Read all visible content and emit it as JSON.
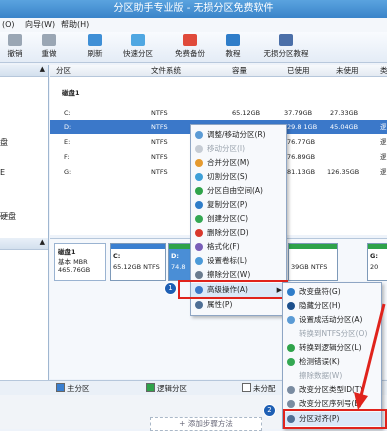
{
  "title": "分区助手专业版 - 无损分区免费软件",
  "menu": [
    "(O)",
    "向导(W)",
    "帮助(H)"
  ],
  "toolbar": [
    {
      "label": "撤销",
      "icon": "undo-icon"
    },
    {
      "label": "重做",
      "icon": "redo-icon"
    },
    {
      "label": "刷新",
      "icon": "refresh-icon"
    },
    {
      "label": "快速分区",
      "icon": "quick-partition-icon"
    },
    {
      "label": "免费备份",
      "icon": "backup-icon"
    },
    {
      "label": "教程",
      "icon": "tutorial-icon"
    },
    {
      "label": "无损分区教程",
      "icon": "lossless-tutorial-icon"
    }
  ],
  "left_panel": {
    "items": [
      "盘",
      "E",
      "",
      "硬盘"
    ]
  },
  "table": {
    "headers": [
      "分区",
      "文件系统",
      "容量",
      "已使用",
      "未使用",
      "类"
    ],
    "disk_label": "磁盘1",
    "rows": [
      {
        "part": "C:",
        "fs": "NTFS",
        "cap": "65.12GB",
        "used": "37.79GB",
        "free": "27.33GB",
        "type": ""
      },
      {
        "part": "D:",
        "fs": "NTFS",
        "cap": "",
        "used": "29.8 1GB",
        "free": "45.04GB",
        "type": "逻"
      },
      {
        "part": "E:",
        "fs": "NTFS",
        "cap": "",
        "used": "76.77GB",
        "free": "",
        "type": "逻"
      },
      {
        "part": "F:",
        "fs": "NTFS",
        "cap": "",
        "used": "76.89GB",
        "free": "",
        "type": "逻"
      },
      {
        "part": "G:",
        "fs": "NTFS",
        "cap": "",
        "used": "81.13GB",
        "free": "126.35GB",
        "type": "逻"
      }
    ]
  },
  "diskmap": {
    "disk": {
      "name": "磁盘1",
      "type": "基本 MBR",
      "size": "465.76GB"
    },
    "parts": [
      {
        "letter": "C:",
        "info": "65.12GB NTFS"
      },
      {
        "letter": "D:",
        "info": "74.8"
      },
      {
        "letter": "",
        "info": "39GB NTFS"
      },
      {
        "letter": "G:",
        "info": "20"
      }
    ]
  },
  "legend": [
    "主分区",
    "逻辑分区",
    "未分配"
  ],
  "bottom_text": "添加步骤方法",
  "context_menu": [
    {
      "label": "调整/移动分区(R)",
      "disabled": false
    },
    {
      "label": "移动分区(I)",
      "disabled": true
    },
    {
      "label": "合并分区(M)",
      "disabled": false
    },
    {
      "label": "切割分区(S)",
      "disabled": false
    },
    {
      "label": "分区自由空间(A)",
      "disabled": false
    },
    {
      "label": "复制分区(P)",
      "disabled": false
    },
    {
      "label": "创建分区(C)",
      "disabled": false
    },
    {
      "label": "删除分区(D)",
      "disabled": false
    },
    {
      "label": "格式化(F)",
      "disabled": false
    },
    {
      "label": "设置卷标(L)",
      "disabled": false
    },
    {
      "label": "擦除分区(W)",
      "disabled": false
    },
    {
      "label": "高级操作(A)",
      "disabled": false
    },
    {
      "label": "属性(P)",
      "disabled": false
    }
  ],
  "submenu": [
    {
      "label": "改变盘符(G)",
      "disabled": false
    },
    {
      "label": "隐藏分区(H)",
      "disabled": false
    },
    {
      "label": "设置成活动分区(A)",
      "disabled": false
    },
    {
      "label": "转换到NTFS分区(O)",
      "disabled": true
    },
    {
      "label": "转换到逻辑分区(L)",
      "disabled": false
    },
    {
      "label": "检测错误(K)",
      "disabled": false
    },
    {
      "label": "擦除数据(W)",
      "disabled": true
    },
    {
      "label": "改变分区类型ID(T)",
      "disabled": false
    },
    {
      "label": "改变分区序列号(E)",
      "disabled": false
    },
    {
      "label": "分区对齐(P)",
      "disabled": false
    }
  ],
  "badges": [
    "1",
    "2"
  ],
  "colors": {
    "title": "#3a84c9",
    "selected": "#3b78c9",
    "highlight": "#e0231c",
    "badge": "#1e5fb4"
  }
}
